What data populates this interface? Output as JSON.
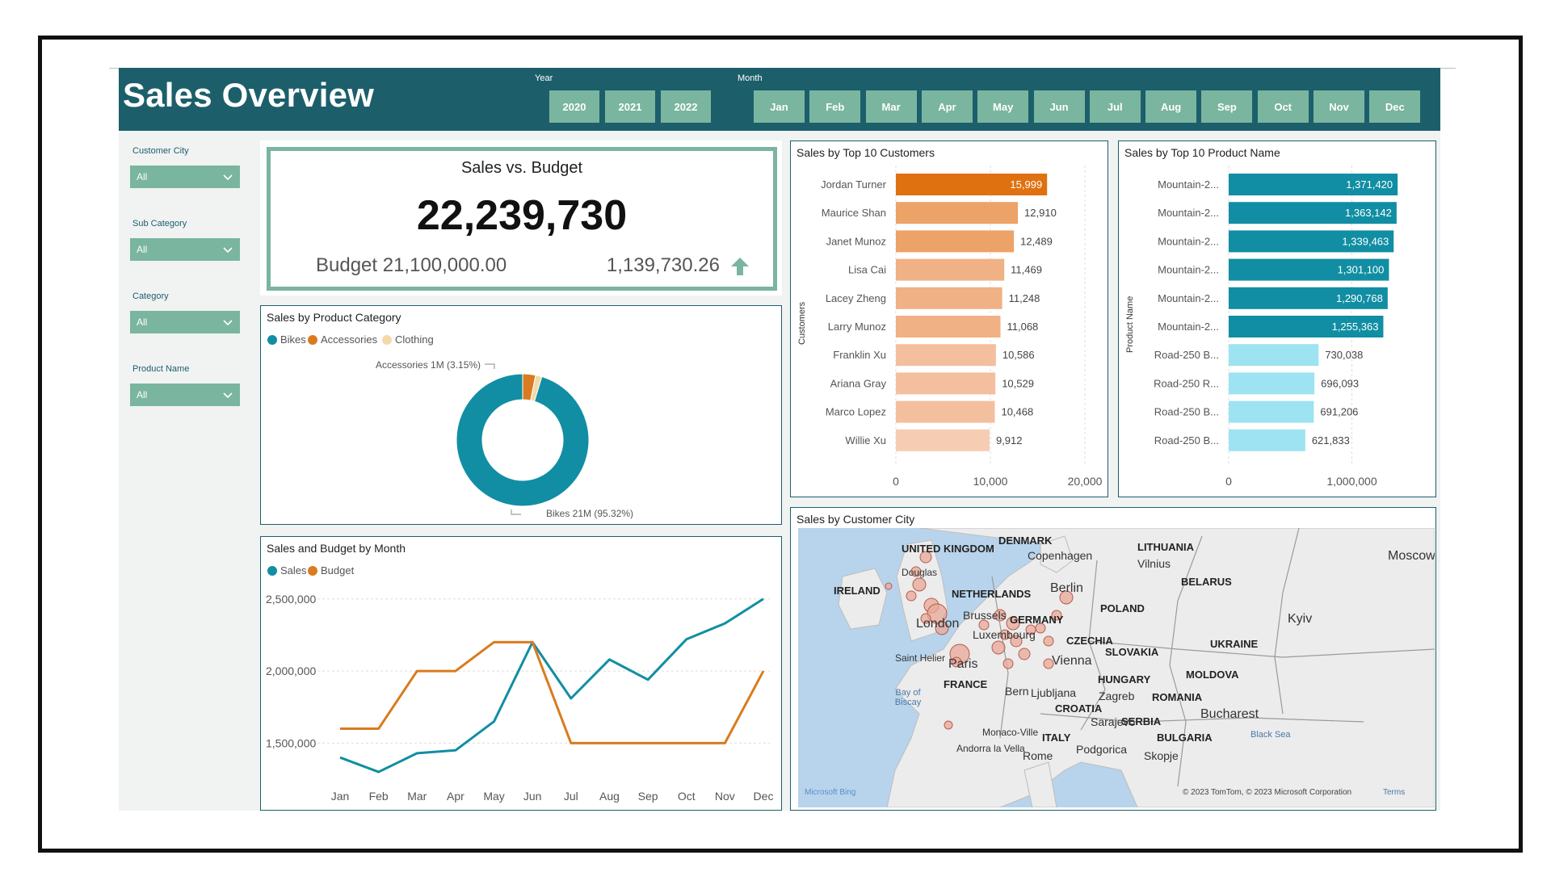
{
  "header": {
    "title": "Sales Overview",
    "year_caption": "Year",
    "month_caption": "Month",
    "years": [
      "2020",
      "2021",
      "2022"
    ],
    "months": [
      "Jan",
      "Feb",
      "Mar",
      "Apr",
      "May",
      "Jun",
      "Jul",
      "Aug",
      "Sep",
      "Oct",
      "Nov",
      "Dec"
    ]
  },
  "filters": [
    {
      "label": "Customer City",
      "value": "All"
    },
    {
      "label": "Sub Category",
      "value": "All"
    },
    {
      "label": "Category",
      "value": "All"
    },
    {
      "label": "Product Name",
      "value": "All"
    }
  ],
  "kpi": {
    "title": "Sales vs. Budget",
    "value": "22,239,730",
    "budget": "Budget 21,100,000.00",
    "difference": "1,139,730.26",
    "trend_icon": "arrow-up-icon"
  },
  "colors": {
    "header": "#1c5f6b",
    "button": "#7ab59f",
    "sales_blue": "#118ea3",
    "budget_orange": "#d97b1e",
    "clothing": "#f3d9a8"
  },
  "product_category": {
    "title": "Sales by Product Category",
    "accessories_label": "Accessories 1M (3.15%)",
    "bikes_label": "Bikes 21M (95.32%)"
  },
  "customers": {
    "title": "Sales by Top 10 Customers",
    "y_axis": "Customers"
  },
  "products": {
    "title": "Sales by Top 10 Product Name",
    "y_axis": "Product Name"
  },
  "monthly": {
    "title": "Sales and Budget by Month"
  },
  "map": {
    "title": "Sales by Customer City",
    "countries": [
      "UNITED KINGDOM",
      "IRELAND",
      "DENMARK",
      "NETHERLANDS",
      "GERMANY",
      "POLAND",
      "LITHUANIA",
      "BELARUS",
      "UKRAINE",
      "CZECHIA",
      "SLOVAKIA",
      "HUNGARY",
      "MOLDOVA",
      "ROMANIA",
      "FRANCE",
      "CROATIA",
      "SERBIA",
      "BULGARIA",
      "ITALY"
    ],
    "cities": [
      "Copenhagen",
      "Vilnius",
      "Berlin",
      "Brussels",
      "Luxembourg",
      "London",
      "Paris",
      "Vienna",
      "Ljubljana",
      "Zagreb",
      "Sarajevo",
      "Bucharest",
      "Kyiv",
      "Saint Helier",
      "Monaco-Ville",
      "Andorra la Vella",
      "Podgorica",
      "Skopje",
      "Rome",
      "Moscow",
      "Douglas",
      "Bern"
    ],
    "water": [
      "Bay of Biscay",
      "Black Sea"
    ],
    "attribution": "© 2023 TomTom, © 2023 Microsoft Corporation",
    "terms": "Terms",
    "logo": "Microsoft Bing"
  },
  "chart_data": [
    {
      "type": "pie",
      "title": "Sales by Product Category",
      "categories": [
        "Bikes",
        "Accessories",
        "Clothing"
      ],
      "values": [
        95.32,
        3.15,
        1.53
      ],
      "unit": "%"
    },
    {
      "type": "bar",
      "title": "Sales by Top 10 Customers",
      "ylabel": "Customers",
      "categories": [
        "Jordan Turner",
        "Maurice Shan",
        "Janet Munoz",
        "Lisa Cai",
        "Lacey Zheng",
        "Larry Munoz",
        "Franklin Xu",
        "Ariana Gray",
        "Marco Lopez",
        "Willie Xu"
      ],
      "values": [
        15999,
        12910,
        12489,
        11469,
        11248,
        11068,
        10586,
        10529,
        10468,
        9912
      ],
      "value_labels": [
        "15,999",
        "12,910",
        "12,489",
        "11,469",
        "11,248",
        "11,068",
        "10,586",
        "10,529",
        "10,468",
        "9,912"
      ],
      "xticks": [
        "0",
        "10,000",
        "20,000"
      ],
      "xlim": [
        0,
        20000
      ]
    },
    {
      "type": "bar",
      "title": "Sales by Top 10 Product Name",
      "ylabel": "Product Name",
      "categories": [
        "Mountain-2...",
        "Mountain-2...",
        "Mountain-2...",
        "Mountain-2...",
        "Mountain-2...",
        "Mountain-2...",
        "Road-250 B...",
        "Road-250 R...",
        "Road-250 B...",
        "Road-250 B..."
      ],
      "values": [
        1371420,
        1363142,
        1339463,
        1301100,
        1290768,
        1255363,
        730038,
        696093,
        691206,
        621833
      ],
      "value_labels": [
        "1,371,420",
        "1,363,142",
        "1,339,463",
        "1,301,100",
        "1,290,768",
        "1,255,363",
        "730,038",
        "696,093",
        "691,206",
        "621,833"
      ],
      "xticks": [
        "0",
        "1,000,000"
      ],
      "xlim": [
        0,
        1600000
      ]
    },
    {
      "type": "line",
      "title": "Sales and Budget by Month",
      "categories": [
        "Jan",
        "Feb",
        "Mar",
        "Apr",
        "May",
        "Jun",
        "Jul",
        "Aug",
        "Sep",
        "Oct",
        "Nov",
        "Dec"
      ],
      "series": [
        {
          "name": "Sales",
          "values": [
            1400000,
            1300000,
            1430000,
            1450000,
            1650000,
            2200000,
            1810000,
            2080000,
            1940000,
            2220000,
            2330000,
            2500000
          ]
        },
        {
          "name": "Budget",
          "values": [
            1600000,
            1600000,
            2000000,
            2000000,
            2200000,
            2200000,
            1500000,
            1500000,
            1500000,
            1500000,
            1500000,
            2000000
          ]
        }
      ],
      "yticks": [
        "1,500,000",
        "2,000,000",
        "2,500,000"
      ],
      "ylim": [
        1250000,
        2650000
      ]
    }
  ]
}
